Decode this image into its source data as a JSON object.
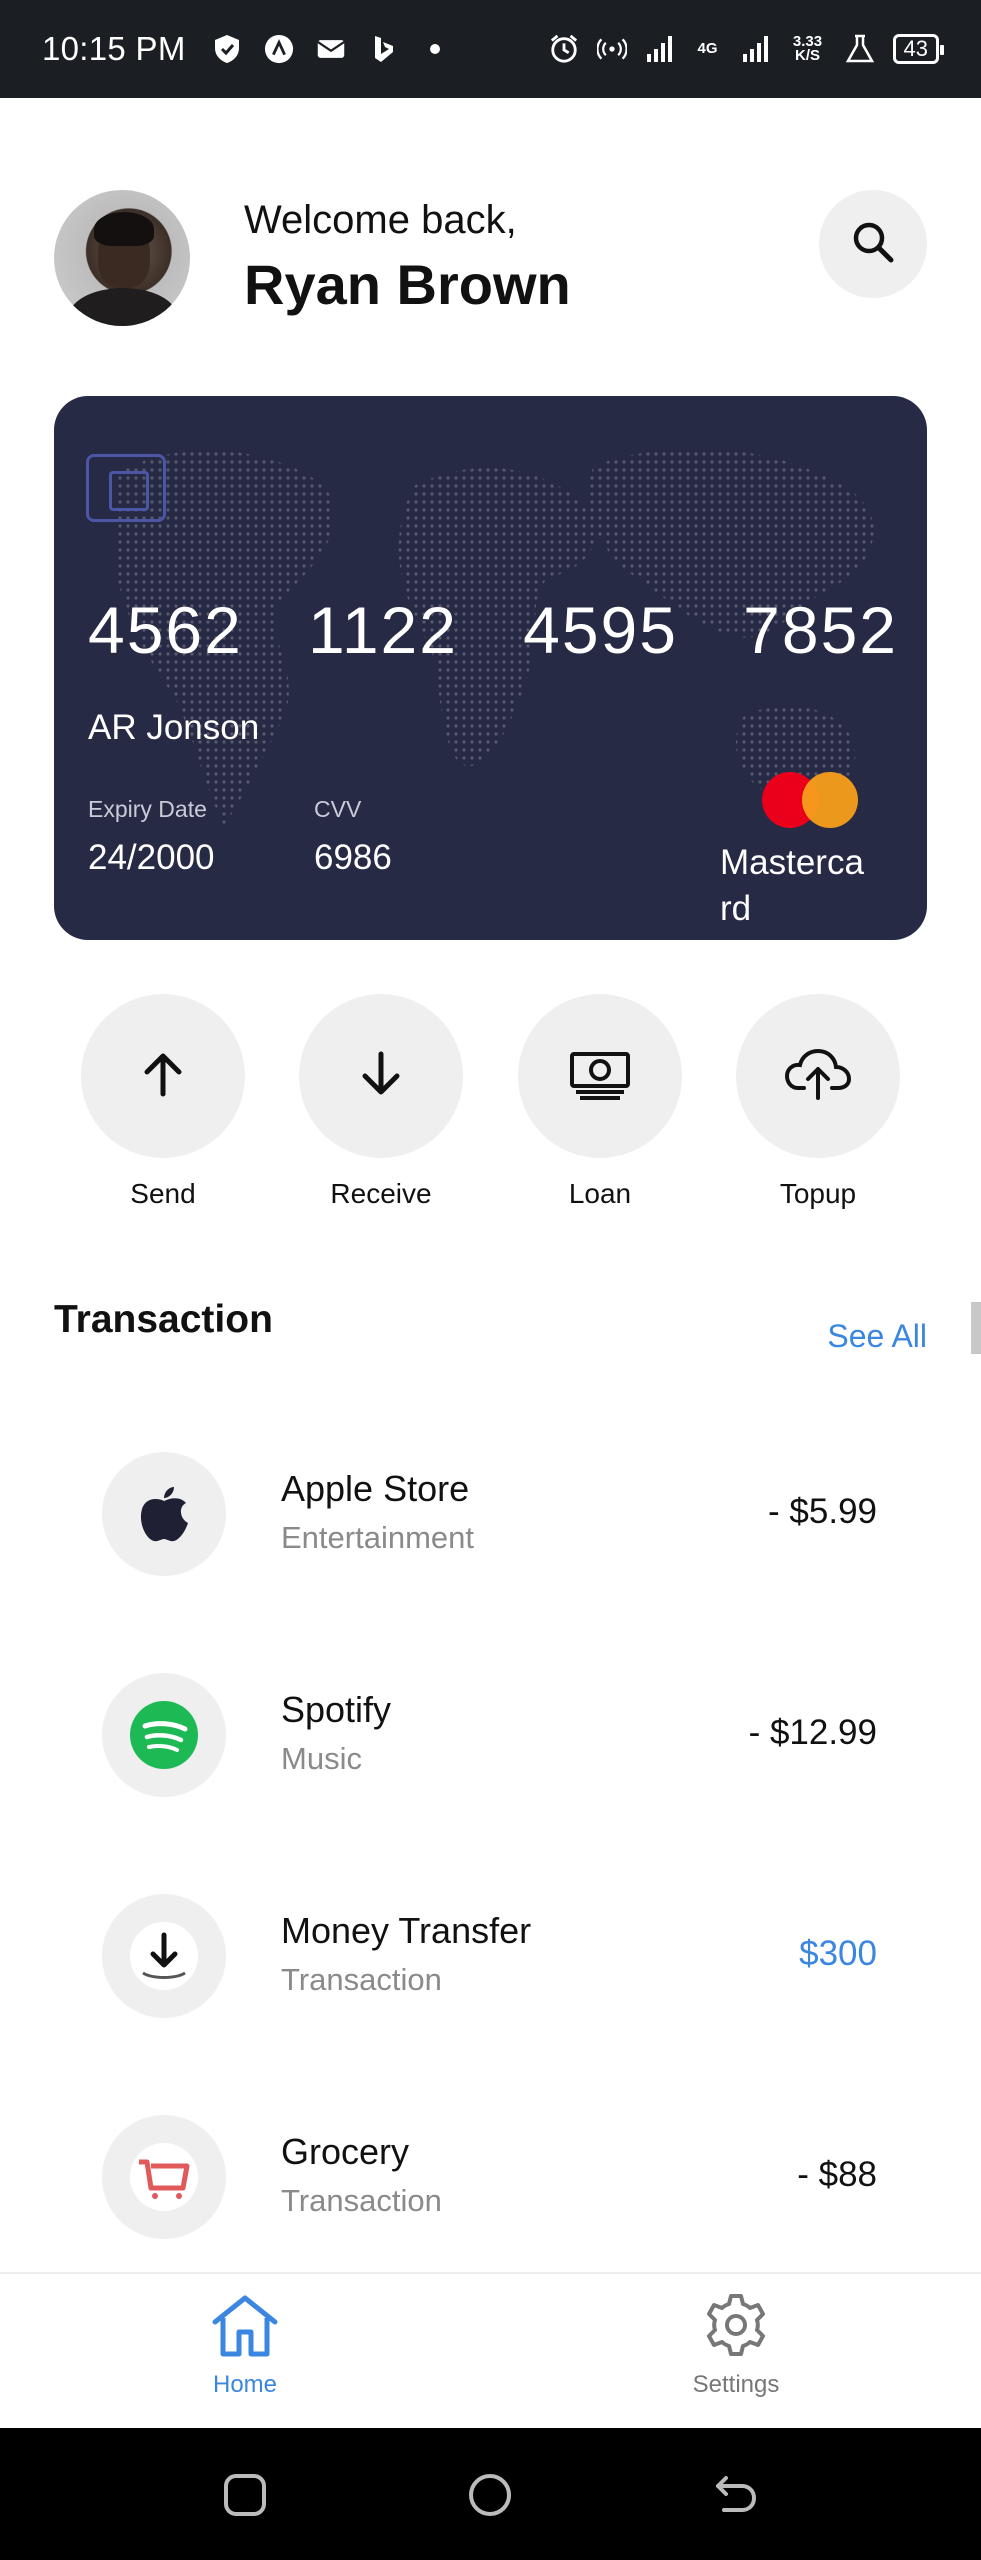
{
  "status_bar": {
    "time": "10:15 PM",
    "network_type": "4G",
    "net_speed_value": "3.33",
    "net_speed_unit": "K/S",
    "battery": "43"
  },
  "header": {
    "welcome": "Welcome back,",
    "user_name": "Ryan Brown"
  },
  "card": {
    "number_groups": [
      "4562",
      "1122",
      "4595",
      "7852"
    ],
    "holder": "AR Jonson",
    "expiry_label": "Expiry Date",
    "expiry_value": "24/2000",
    "cvv_label": "CVV",
    "cvv_value": "6986",
    "brand": "Mastercard"
  },
  "actions": [
    {
      "label": "Send",
      "icon": "arrow-up-icon"
    },
    {
      "label": "Receive",
      "icon": "arrow-down-icon"
    },
    {
      "label": "Loan",
      "icon": "money-icon"
    },
    {
      "label": "Topup",
      "icon": "cloud-upload-icon"
    }
  ],
  "transactions": {
    "title": "Transaction",
    "see_all": "See All",
    "items": [
      {
        "name": "Apple Store",
        "category": "Entertainment",
        "amount": "- $5.99",
        "icon": "apple-icon"
      },
      {
        "name": "Spotify",
        "category": "Music",
        "amount": "- $12.99",
        "icon": "spotify-icon"
      },
      {
        "name": "Money Transfer",
        "category": "Transaction",
        "amount": "$300",
        "icon": "download-icon"
      },
      {
        "name": "Grocery",
        "category": "Transaction",
        "amount": "- $88",
        "icon": "cart-icon"
      }
    ]
  },
  "bottom_nav": {
    "home": "Home",
    "settings": "Settings"
  },
  "colors": {
    "accent": "#3a86e0",
    "card_bg": "#272a45",
    "status_bar_bg": "#1b1f24"
  }
}
